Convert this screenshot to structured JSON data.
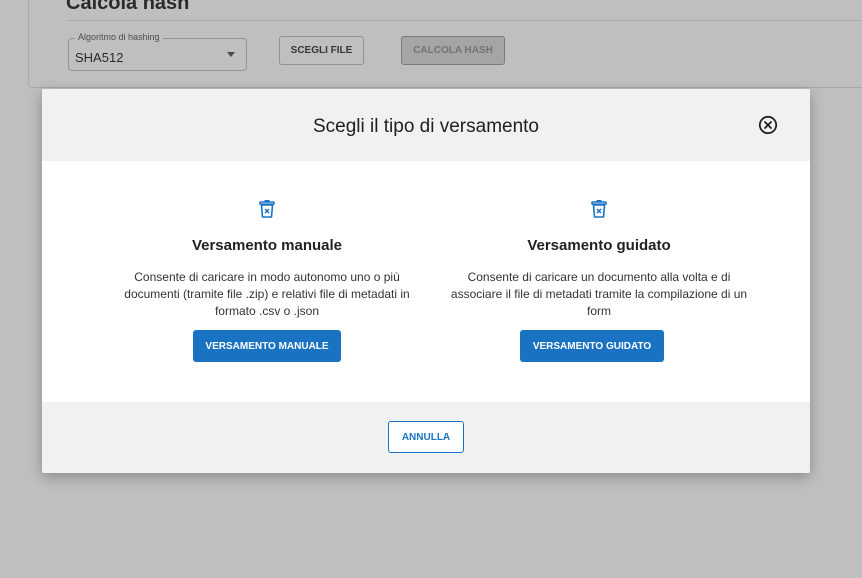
{
  "background": {
    "page_title": "Calcola hash",
    "hash_select": {
      "label": "Algoritmo di hashing",
      "value": "SHA512"
    },
    "choose_file_label": "SCEGLI FILE",
    "compute_hash_label": "CALCOLA HASH"
  },
  "modal": {
    "title": "Scegli il tipo di versamento",
    "options": [
      {
        "icon": "trash-bin-icon",
        "title": "Versamento manuale",
        "description": "Consente di caricare in modo autonomo uno o più documenti (tramite file .zip) e relativi file di metadati in formato .csv o .json",
        "button_label": "VERSAMENTO MANUALE"
      },
      {
        "icon": "trash-bin-icon",
        "title": "Versamento guidato",
        "description": "Consente di caricare un documento alla volta e di associare il file di metadati tramite la compilazione di un form",
        "button_label": "VERSAMENTO GUIDATO"
      }
    ],
    "cancel_label": "ANNULLA"
  },
  "colors": {
    "primary": "#1a73c2",
    "header_bg": "#f0f1f3"
  }
}
